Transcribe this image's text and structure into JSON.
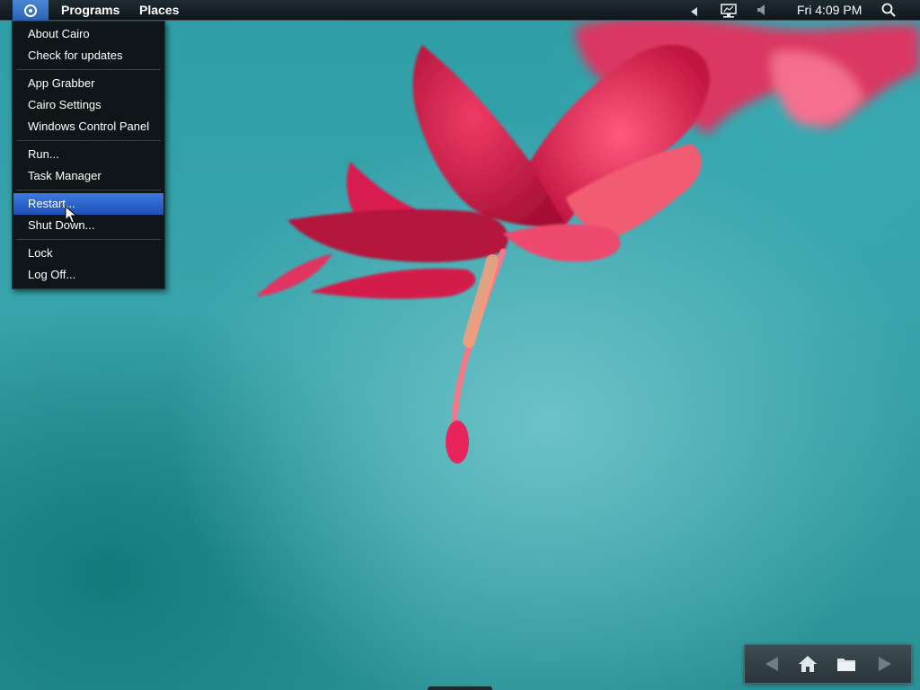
{
  "menubar": {
    "start_icon": "cairo-start-icon",
    "programs_label": "Programs",
    "places_label": "Places",
    "clock": "Fri 4:09 PM",
    "tray_icons": [
      "tray-expand-icon",
      "network-icon",
      "volume-icon",
      "search-icon"
    ]
  },
  "cairo_menu": {
    "groups": [
      [
        "About Cairo",
        "Check for updates"
      ],
      [
        "App Grabber",
        "Cairo Settings",
        "Windows Control Panel"
      ],
      [
        "Run...",
        "Task Manager"
      ],
      [
        "Restart...",
        "Shut Down..."
      ],
      [
        "Lock",
        "Log Off..."
      ]
    ],
    "highlighted_item": "Restart...",
    "highlight_color": "#2b63cc"
  },
  "navigation_widget": {
    "icons": [
      "back-arrow-icon",
      "home-icon",
      "folder-icon",
      "forward-arrow-icon"
    ]
  },
  "colors": {
    "accent": "#3a78d8",
    "menubar_bg": "#141d22",
    "menu_bg": "#0f1619",
    "wallpaper_base": "#2f9aa3",
    "flower": "#e0245a"
  }
}
